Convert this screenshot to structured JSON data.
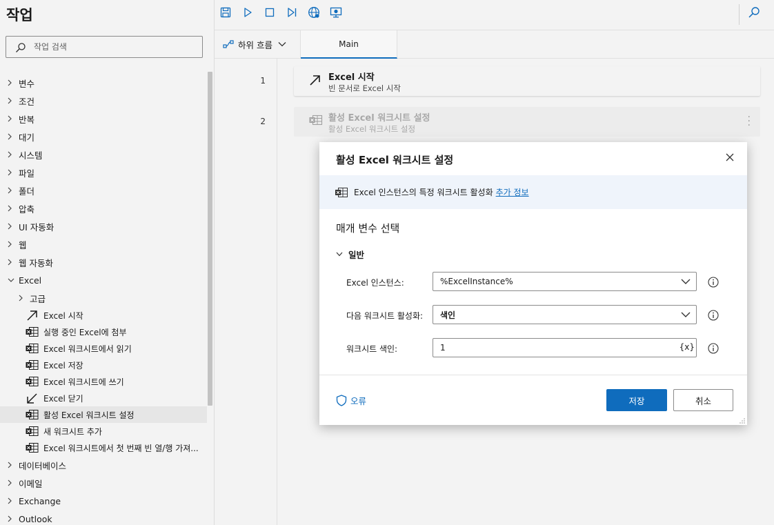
{
  "left_panel": {
    "title": "작업",
    "search_placeholder": "작업 검색",
    "categories_top": [
      {
        "label": "변수"
      },
      {
        "label": "조건"
      },
      {
        "label": "반복"
      },
      {
        "label": "대기"
      },
      {
        "label": "시스템"
      },
      {
        "label": "파일"
      },
      {
        "label": "폴더"
      },
      {
        "label": "압축"
      },
      {
        "label": "UI 자동화"
      },
      {
        "label": "웹"
      },
      {
        "label": "웹 자동화"
      }
    ],
    "excel_group": {
      "label": "Excel",
      "expanded": true,
      "subgroup": "고급",
      "actions": [
        {
          "label": "Excel 시작",
          "icon": "arrow-up-right-icon"
        },
        {
          "label": "실행 중인 Excel에 첨부",
          "icon": "excel-sheet-icon"
        },
        {
          "label": "Excel 워크시트에서 읽기",
          "icon": "excel-sheet-icon"
        },
        {
          "label": "Excel 저장",
          "icon": "excel-sheet-icon"
        },
        {
          "label": "Excel 워크시트에 쓰기",
          "icon": "excel-sheet-icon"
        },
        {
          "label": "Excel 닫기",
          "icon": "arrow-down-left-icon"
        },
        {
          "label": "활성 Excel 워크시트 설정",
          "icon": "excel-sheet-icon",
          "selected": true
        },
        {
          "label": "새 워크시트 추가",
          "icon": "excel-sheet-icon"
        },
        {
          "label": "Excel 워크시트에서 첫 번째 빈 열/행 가져...",
          "icon": "excel-sheet-icon"
        }
      ]
    },
    "categories_bottom": [
      {
        "label": "데이터베이스"
      },
      {
        "label": "이메일"
      },
      {
        "label": "Exchange"
      },
      {
        "label": "Outlook"
      }
    ]
  },
  "toolbar": {
    "icons": [
      "save-icon",
      "run-icon",
      "stop-icon",
      "step-icon",
      "web-recorder-icon",
      "desktop-recorder-icon",
      "search-icon"
    ],
    "accent": "#0f6cbd"
  },
  "tabs": {
    "subflows_label": "하위 흐름",
    "main_tab": "Main"
  },
  "flow": {
    "steps": [
      {
        "line": "1",
        "title": "Excel 시작",
        "desc": "빈 문서로 Excel 시작",
        "icon": "arrow-up-right-icon"
      },
      {
        "line": "2",
        "title": "활성 Excel 워크시트 설정",
        "desc": "활성 Excel 워크시트 설정",
        "icon": "excel-sheet-icon"
      }
    ]
  },
  "dialog": {
    "title": "활성 Excel 워크시트 설정",
    "info_text": "Excel 인스턴스의 특정 워크시트 활성화",
    "info_link": "추가 정보",
    "param_heading": "매개 변수 선택",
    "section": "일반",
    "fields": {
      "instance": {
        "label": "Excel 인스턴스:",
        "value": "%ExcelInstance%"
      },
      "activate_with": {
        "label": "다음 워크시트 활성화:",
        "value": "색인"
      },
      "index": {
        "label": "워크시트 색인:",
        "value": "1",
        "var_button": "{x}"
      }
    },
    "errors_label": "오류",
    "save_label": "저장",
    "cancel_label": "취소"
  }
}
